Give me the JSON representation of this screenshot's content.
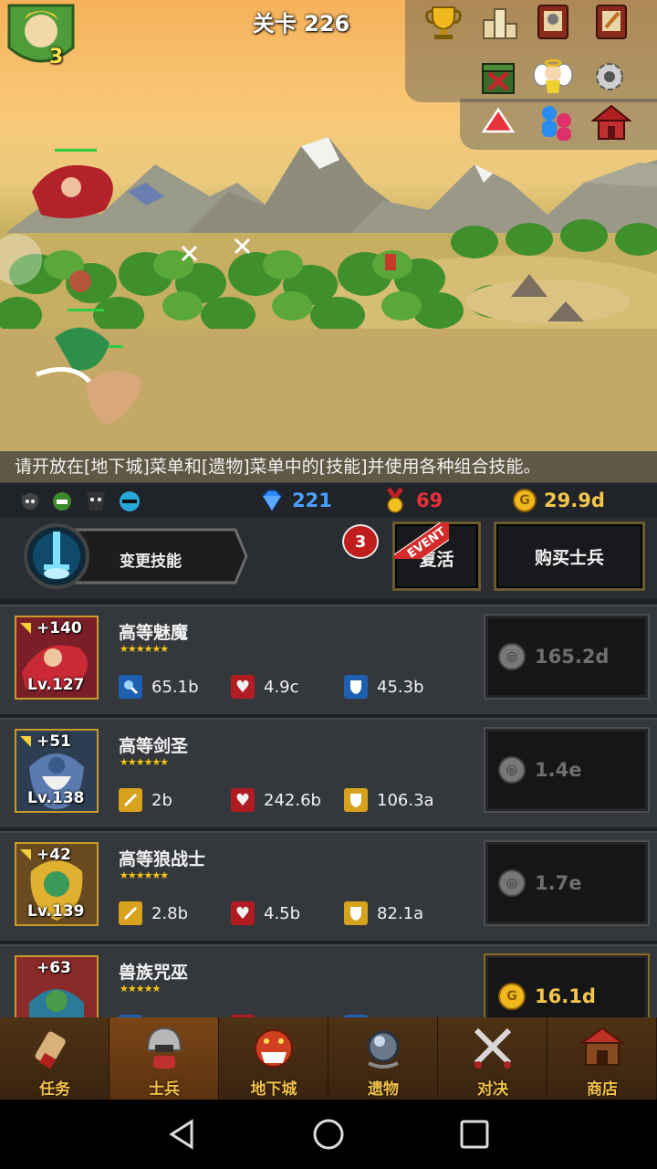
{
  "stage": {
    "label": "关卡 226"
  },
  "hero": {
    "badge": "3"
  },
  "hint": "请开放在[地下城]菜单和[遗物]菜单中的[技能]并使用各种组合技能。",
  "resources": {
    "diamonds": "221",
    "medals": "69",
    "gold": "29.9d"
  },
  "actions": {
    "change_skill": "变更技能",
    "badge_count": "3",
    "event_tag": "EVENT",
    "revive": "复活",
    "buy_soldier": "购买士兵"
  },
  "units": [
    {
      "name": "高等魅魔",
      "bonus": "+140",
      "level": "Lv.127",
      "stars": "★★★★★★",
      "stats": [
        "65.1b",
        "4.9c",
        "45.3b"
      ],
      "price": "165.2d",
      "affordable": false
    },
    {
      "name": "高等剑圣",
      "bonus": "+51",
      "level": "Lv.138",
      "stars": "★★★★★★",
      "stats": [
        "2b",
        "242.6b",
        "106.3a"
      ],
      "price": "1.4e",
      "affordable": false
    },
    {
      "name": "高等狼战士",
      "bonus": "+42",
      "level": "Lv.139",
      "stars": "★★★★★★",
      "stats": [
        "2.8b",
        "4.5b",
        "82.1a"
      ],
      "price": "1.7e",
      "affordable": false
    },
    {
      "name": "兽族咒巫",
      "bonus": "+63",
      "level": "",
      "stars": "★★★★★",
      "stats": [
        "",
        "",
        ""
      ],
      "price": "16.1d",
      "affordable": true
    }
  ],
  "nav": {
    "tabs": [
      {
        "label": "任务",
        "icon": "scroll-icon"
      },
      {
        "label": "士兵",
        "icon": "helmet-icon"
      },
      {
        "label": "地下城",
        "icon": "monster-icon"
      },
      {
        "label": "遗物",
        "icon": "orb-icon"
      },
      {
        "label": "对决",
        "icon": "crossed-swords-icon"
      },
      {
        "label": "商店",
        "icon": "shop-icon"
      }
    ],
    "active": "士兵"
  },
  "colors": {
    "gold": "#f3c64a",
    "diamond": "#2f8cff",
    "medal": "#e03030",
    "nav_bg": "#3a2410"
  }
}
